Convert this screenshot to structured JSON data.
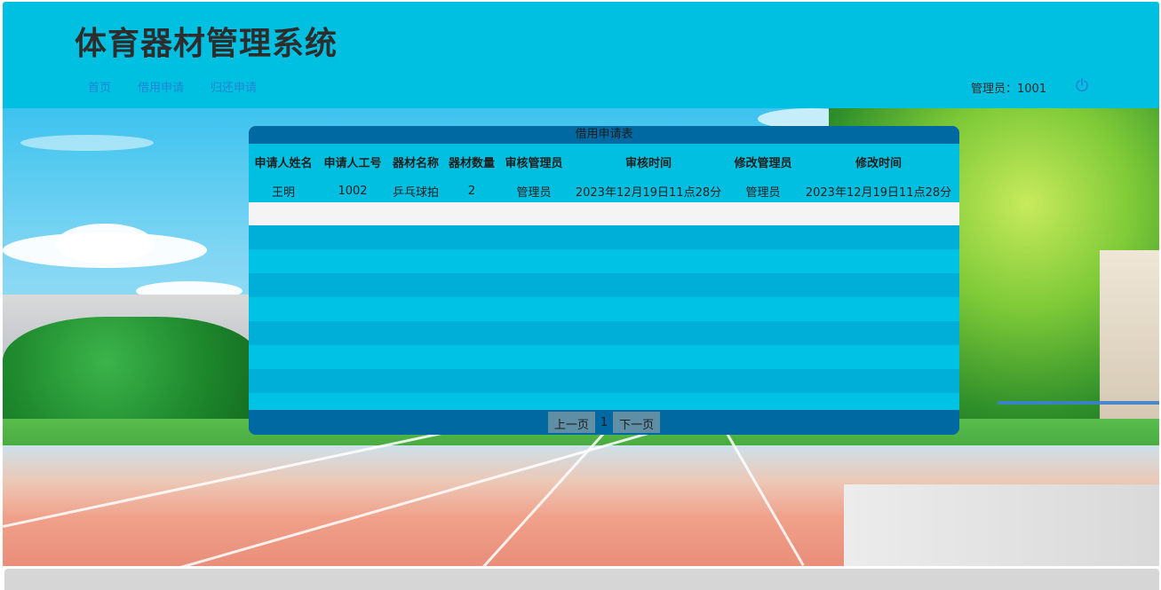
{
  "header": {
    "title": "体育器材管理系统",
    "nav": [
      {
        "label": "首页"
      },
      {
        "label": "借用申请"
      },
      {
        "label": "归还申请"
      }
    ],
    "admin_label": "管理员：1001",
    "logout_icon": "power-icon"
  },
  "table": {
    "caption": "借用申请表",
    "columns": [
      "申请人姓名",
      "申请人工号",
      "器材名称",
      "器材数量",
      "审核管理员",
      "审核时间",
      "修改管理员",
      "修改时间"
    ],
    "rows": [
      [
        "王明",
        "1002",
        "乒乓球拍",
        "2",
        "管理员",
        "2023年12月19日11点28分",
        "管理员",
        "2023年12月19日11点28分"
      ]
    ]
  },
  "pager": {
    "prev_label": "上一页",
    "page": "1",
    "next_label": "下一页"
  },
  "colors": {
    "header_bg": "#00c0e2",
    "nav_link": "#1d86d3",
    "panel_dark": "#0069a2",
    "row_bg": "#00bfe0"
  }
}
